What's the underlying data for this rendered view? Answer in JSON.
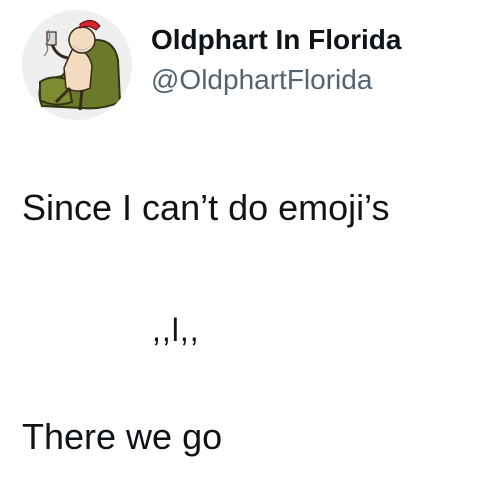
{
  "author": {
    "display_name": "Oldphart In Florida",
    "handle": "@OldphartFlorida",
    "avatar_icon": "cartoon-old-man-in-recliner-avatar"
  },
  "tweet": {
    "lines": [
      "Since I can’t do emoji’s",
      ",,l,,",
      "There we go"
    ]
  },
  "colors": {
    "text": "#0f1419",
    "secondary_text": "#536471",
    "background": "#ffffff"
  }
}
